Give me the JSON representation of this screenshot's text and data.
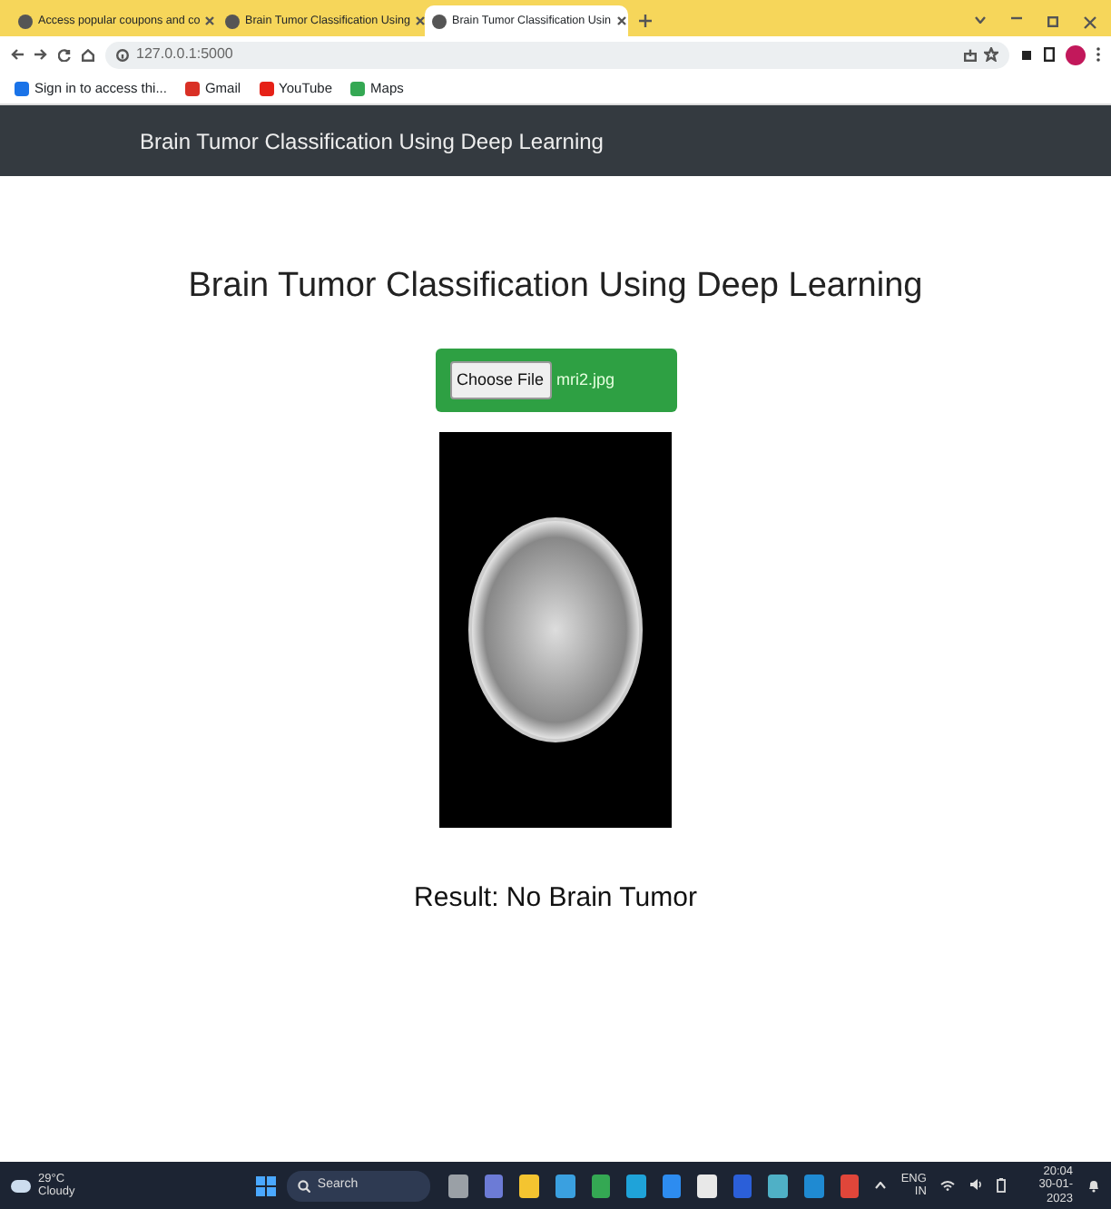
{
  "browser": {
    "tabs": [
      {
        "label": "Access popular coupons and co",
        "selected": false
      },
      {
        "label": "Brain Tumor Classification Using",
        "selected": false
      },
      {
        "label": "Brain Tumor Classification Usin",
        "selected": true
      }
    ],
    "address": "127.0.0.1:5000",
    "bookmarks": [
      {
        "label": "Sign in to access thi...",
        "color": "#1a73e8"
      },
      {
        "label": "Gmail",
        "color": "#d93025"
      },
      {
        "label": "YouTube",
        "color": "#e62117"
      },
      {
        "label": "Maps",
        "color": "#34a853"
      }
    ]
  },
  "navbar": {
    "brand": "Brain Tumor Classification Using Deep Learning"
  },
  "page": {
    "heading": "Brain Tumor Classification Using Deep Learning",
    "upload": {
      "button": "Choose File",
      "filename": "mri2.jpg"
    },
    "result": "Result: No Brain Tumor"
  },
  "taskbar": {
    "weather": {
      "temperature": "29°C",
      "condition": "Cloudy"
    },
    "search": {
      "placeholder": "Search"
    },
    "apps": [
      {
        "color": "#9aa0a6"
      },
      {
        "color": "#6c7bd6"
      },
      {
        "color": "#f4c430"
      },
      {
        "color": "#3aa0e0"
      },
      {
        "color": "#34a853"
      },
      {
        "color": "#1fa3d9"
      },
      {
        "color": "#2d8cf0"
      },
      {
        "color": "#e8e8e8"
      },
      {
        "color": "#2b5fd9"
      },
      {
        "color": "#4fb0c6"
      },
      {
        "color": "#1f8ad2"
      },
      {
        "color": "#e0463a"
      }
    ],
    "language": "ENG",
    "region": "IN",
    "time": "20:04",
    "date": "30-01-2023"
  }
}
